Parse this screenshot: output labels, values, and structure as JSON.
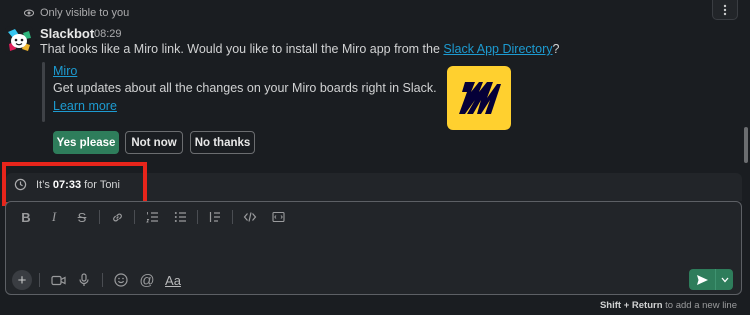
{
  "notice": {
    "text": "Only visible to you"
  },
  "message": {
    "sender": "Slackbot",
    "time": "08:29",
    "text_before": "That looks like a Miro link. Would you like to install the Miro app from the ",
    "link_text": "Slack App Directory",
    "text_after": "?"
  },
  "attachment": {
    "title": "Miro",
    "body": "Get updates about all the changes on your Miro boards right in Slack.",
    "learn_more": "Learn more",
    "logo_icon": "miro-logo"
  },
  "buttons": {
    "yes": "Yes please",
    "not_now": "Not now",
    "no_thanks": "No thanks"
  },
  "timezone": {
    "prefix": "It’s",
    "time": "07:33",
    "suffix": "for Toni"
  },
  "composer": {
    "format_icons": [
      "bold-icon",
      "italic-icon",
      "strikethrough-icon",
      "link-icon",
      "numbered-list-icon",
      "bulleted-list-icon",
      "blockquote-icon",
      "code-icon",
      "code-block-icon"
    ],
    "bottom_icons": [
      "plus-icon",
      "video-icon",
      "microphone-icon",
      "emoji-icon",
      "mention-icon",
      "formatting-toggle-icon"
    ],
    "aa_label": "Aa",
    "hint_key": "Shift + Return",
    "hint_rest": "to add a new line"
  },
  "colors": {
    "background": "#1a1d21",
    "primary_button": "#2e7d5b",
    "link": "#1d9bd1",
    "highlight": "#e8251b",
    "miro_yellow": "#ffd02f"
  }
}
